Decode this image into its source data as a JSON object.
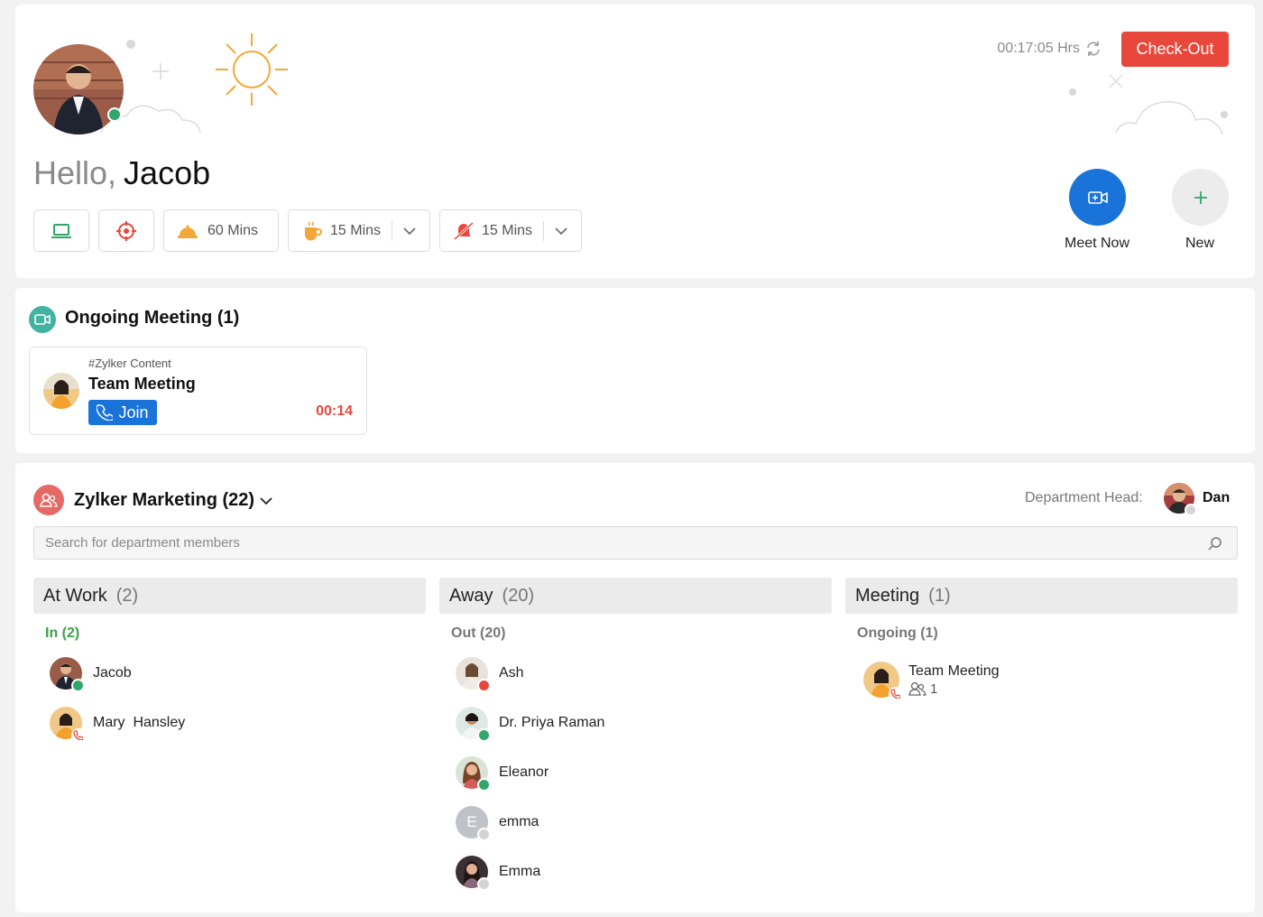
{
  "user": {
    "greeting": "Hello,",
    "name": "Jacob"
  },
  "timer": {
    "value": "00:17:05 Hrs"
  },
  "checkout_label": "Check-Out",
  "chips": [
    {
      "icon": "laptop-icon"
    },
    {
      "icon": "target-icon"
    },
    {
      "icon": "lunch-icon",
      "label": "60 Mins"
    },
    {
      "icon": "coffee-icon",
      "label": "15 Mins"
    },
    {
      "icon": "do-not-disturb-icon",
      "label": "15 Mins"
    }
  ],
  "actions": {
    "meet_now": "Meet Now",
    "new": "New"
  },
  "ongoing": {
    "title": "Ongoing Meeting (1)",
    "meeting": {
      "channel": "#Zylker Content",
      "title": "Team Meeting",
      "join_label": "Join",
      "elapsed": "00:14"
    }
  },
  "department": {
    "title": "Zylker Marketing (22)",
    "head_label": "Department Head:",
    "head_name": "Dan",
    "search_placeholder": "Search for department members"
  },
  "columns": {
    "at_work": {
      "label": "At Work",
      "count": "(2)",
      "sub": "In (2)",
      "members": [
        "Jacob",
        "Mary  Hansley"
      ]
    },
    "away": {
      "label": "Away",
      "count": "(20)",
      "sub": "Out (20)",
      "members": [
        "Ash",
        "Dr. Priya Raman",
        "Eleanor",
        "emma",
        "Emma"
      ],
      "initial": "E"
    },
    "meeting": {
      "label": "Meeting",
      "count": "(1)",
      "sub": "Ongoing (1)",
      "item": {
        "title": "Team Meeting",
        "participants": "1"
      }
    }
  },
  "colors": {
    "accent_blue": "#1a73d9",
    "checkout_red": "#e8483c",
    "online_green": "#2fa86a",
    "in_green": "#3aa34a",
    "busy_red": "#e8483c"
  }
}
